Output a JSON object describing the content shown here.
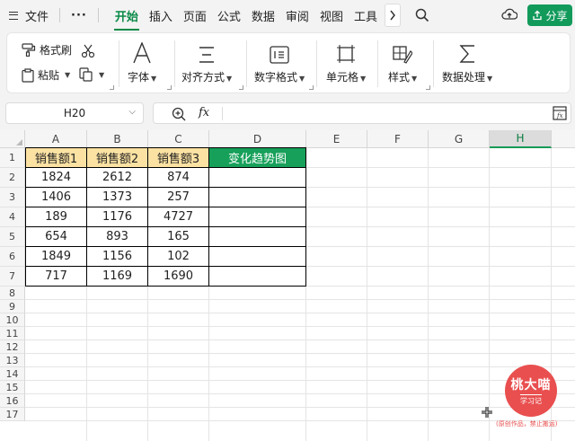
{
  "menubar": {
    "file_label": "文件",
    "more_label": "···",
    "tabs": [
      "开始",
      "插入",
      "页面",
      "公式",
      "数据",
      "审阅",
      "视图",
      "工具"
    ],
    "active_tab": "开始",
    "share_label": "分享"
  },
  "ribbon": {
    "format_painter": "格式刷",
    "paste": "粘贴",
    "font": "字体",
    "alignment": "对齐方式",
    "number_format": "数字格式",
    "cells": "单元格",
    "styles": "样式",
    "data_processing": "数据处理"
  },
  "formula_bar": {
    "cell_ref": "H20",
    "fx_label": "fx",
    "formula": ""
  },
  "sheet": {
    "columns": [
      "A",
      "B",
      "C",
      "D",
      "E",
      "F",
      "G",
      "H"
    ],
    "selected_column": "H",
    "rows": [
      "1",
      "2",
      "3",
      "4",
      "5",
      "6",
      "7",
      "8",
      "9",
      "10",
      "11",
      "12",
      "13",
      "14",
      "15",
      "16",
      "17"
    ],
    "headers": [
      "销售额1",
      "销售额2",
      "销售额3",
      "变化趋势图"
    ],
    "data": [
      [
        "1824",
        "2612",
        "874",
        ""
      ],
      [
        "1406",
        "1373",
        "257",
        ""
      ],
      [
        "189",
        "1176",
        "4727",
        ""
      ],
      [
        "654",
        "893",
        "165",
        ""
      ],
      [
        "1849",
        "1156",
        "102",
        ""
      ],
      [
        "717",
        "1169",
        "1690",
        ""
      ]
    ]
  },
  "watermark": {
    "title": "桃大喵",
    "subtitle": "学习记",
    "note": "(原创作品，禁止搬运)"
  },
  "colors": {
    "accent": "#0a8a47",
    "header_fill": "#fbe2a3",
    "trend_header_fill": "#17a05a",
    "share_button": "#129a5b",
    "stamp": "#e94f4f"
  }
}
